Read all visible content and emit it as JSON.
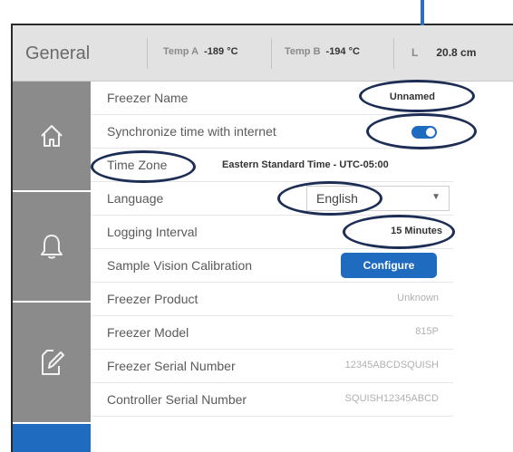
{
  "header": {
    "title": "General",
    "temp_a": {
      "label": "Temp A",
      "value": "-189 °C"
    },
    "temp_b": {
      "label": "Temp B",
      "value": "-194 °C"
    },
    "level": {
      "label": "L",
      "value": "20.8 cm"
    }
  },
  "sidebar": {
    "items": [
      {
        "icon": "home-icon"
      },
      {
        "icon": "bell-icon"
      },
      {
        "icon": "edit-note-icon"
      }
    ]
  },
  "settings": {
    "freezer_name": {
      "label": "Freezer Name",
      "value": "Unnamed"
    },
    "sync_time": {
      "label": "Synchronize time with internet",
      "enabled": true
    },
    "time_zone": {
      "label": "Time Zone",
      "value": "Eastern Standard Time - UTC-05:00"
    },
    "language": {
      "label": "Language",
      "value": "English"
    },
    "logging_interval": {
      "label": "Logging Interval",
      "value": "15 Minutes"
    },
    "sample_vision": {
      "label": "Sample Vision Calibration",
      "button": "Configure"
    },
    "freezer_product": {
      "label": "Freezer Product",
      "value": "Unknown"
    },
    "freezer_model": {
      "label": "Freezer Model",
      "value": "815P"
    },
    "serial_number": {
      "label": "Freezer Serial Number",
      "value": "12345ABCDSQUISH"
    },
    "controller_serial": {
      "label": "Controller Serial Number",
      "value": "SQUISH12345ABCD"
    }
  },
  "colors": {
    "accent": "#1e6bc0",
    "sidebar": "#8b8b8b",
    "annotation": "#1d2e55"
  }
}
